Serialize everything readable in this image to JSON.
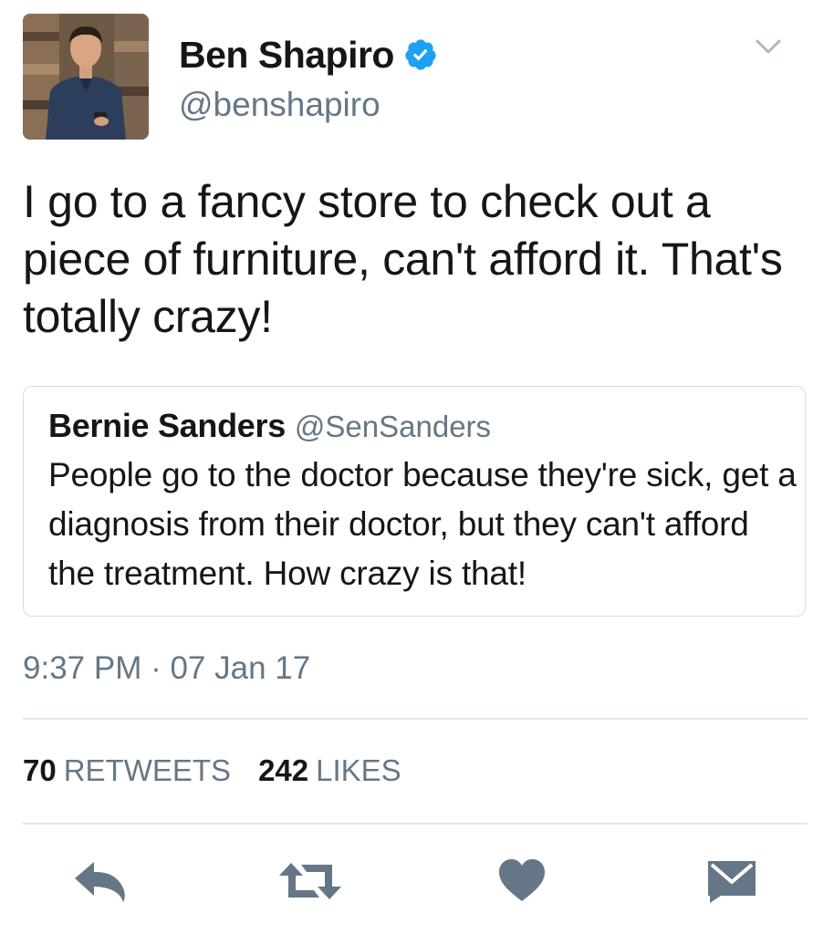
{
  "author": {
    "display_name": "Ben Shapiro",
    "handle": "@benshapiro",
    "verified": true,
    "avatar": "profile-photo"
  },
  "tweet": {
    "text": "I go to a fancy store to check out a piece of furniture, can't afford it. That's totally crazy!",
    "timestamp": "9:37 PM · 07 Jan 17"
  },
  "quoted_tweet": {
    "display_name": "Bernie Sanders",
    "handle": "@SenSanders",
    "text": "People go to the doctor because they're sick, get a diagnosis from their doctor, but they can't afford the treatment. How crazy is that!"
  },
  "stats": {
    "retweets_count": "70",
    "retweets_label": "RETWEETS",
    "likes_count": "242",
    "likes_label": "LIKES"
  },
  "actions": {
    "reply_icon": "reply-icon",
    "retweet_icon": "retweet-icon",
    "like_icon": "heart-icon",
    "message_icon": "envelope-icon"
  },
  "colors": {
    "verified_blue": "#1da1f2",
    "secondary_text": "#657786",
    "action_icon": "#657786",
    "border": "#e1e8ed"
  }
}
